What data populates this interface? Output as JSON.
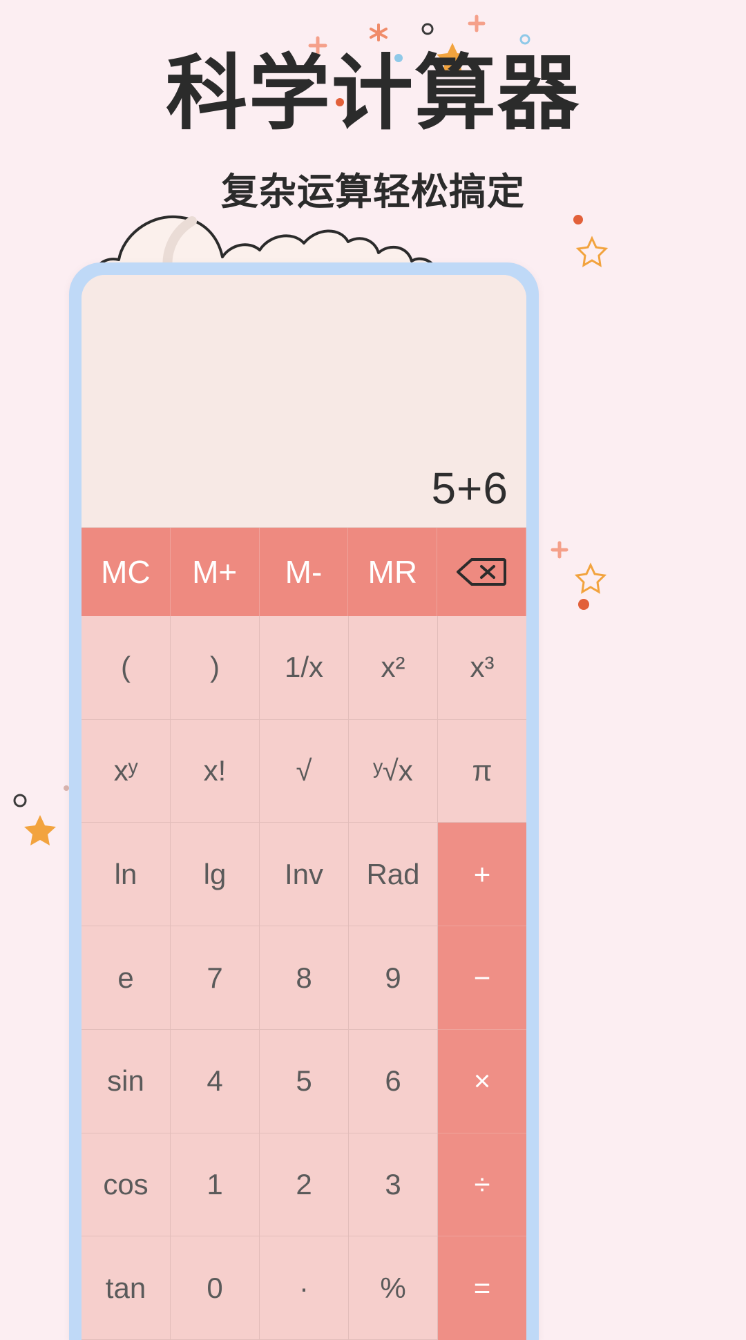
{
  "theme": {
    "page_bg": "#FCEEF2",
    "phone_frame": "#BFD9F7",
    "display_bg": "#F7E9E5",
    "key_bg": "#F6CFCC",
    "key_text": "#5A5A5A",
    "memory_bg": "#EE8A80",
    "operator_bg": "#EF8F86",
    "accent_text": "#FFFFFF",
    "title_color": "#2B2B2B"
  },
  "header": {
    "title": "科学计算器",
    "subtitle": "复杂运算轻松搞定"
  },
  "calculator": {
    "display": {
      "expression": "5+6"
    },
    "memory_row": [
      {
        "label": "MC",
        "name": "key-memory-clear"
      },
      {
        "label": "M+",
        "name": "key-memory-add"
      },
      {
        "label": "M-",
        "name": "key-memory-subtract"
      },
      {
        "label": "MR",
        "name": "key-memory-recall"
      },
      {
        "label": "",
        "name": "key-backspace",
        "icon": "backspace-icon"
      }
    ],
    "rows": [
      [
        {
          "label": "(",
          "name": "key-open-paren",
          "type": "fn"
        },
        {
          "label": ")",
          "name": "key-close-paren",
          "type": "fn"
        },
        {
          "label": "1/x",
          "name": "key-reciprocal",
          "type": "fn"
        },
        {
          "label": "x²",
          "name": "key-square",
          "type": "fn"
        },
        {
          "label": "x³",
          "name": "key-cube",
          "type": "fn"
        }
      ],
      [
        {
          "label": "xʸ",
          "name": "key-power",
          "type": "fn"
        },
        {
          "label": "x!",
          "name": "key-factorial",
          "type": "fn"
        },
        {
          "label": "√",
          "name": "key-square-root",
          "type": "fn"
        },
        {
          "label": "ʸ√x",
          "name": "key-nth-root",
          "type": "fn"
        },
        {
          "label": "π",
          "name": "key-pi",
          "type": "fn"
        }
      ],
      [
        {
          "label": "ln",
          "name": "key-natural-log",
          "type": "fn"
        },
        {
          "label": "lg",
          "name": "key-log10",
          "type": "fn"
        },
        {
          "label": "Inv",
          "name": "key-inverse",
          "type": "fn"
        },
        {
          "label": "Rad",
          "name": "key-radian-mode",
          "type": "fn"
        },
        {
          "label": "+",
          "name": "key-plus",
          "type": "op"
        }
      ],
      [
        {
          "label": "e",
          "name": "key-euler",
          "type": "fn"
        },
        {
          "label": "7",
          "name": "key-7",
          "type": "num"
        },
        {
          "label": "8",
          "name": "key-8",
          "type": "num"
        },
        {
          "label": "9",
          "name": "key-9",
          "type": "num"
        },
        {
          "label": "−",
          "name": "key-minus",
          "type": "op"
        }
      ],
      [
        {
          "label": "sin",
          "name": "key-sine",
          "type": "fn"
        },
        {
          "label": "4",
          "name": "key-4",
          "type": "num"
        },
        {
          "label": "5",
          "name": "key-5",
          "type": "num"
        },
        {
          "label": "6",
          "name": "key-6",
          "type": "num"
        },
        {
          "label": "×",
          "name": "key-multiply",
          "type": "op"
        }
      ],
      [
        {
          "label": "cos",
          "name": "key-cosine",
          "type": "fn"
        },
        {
          "label": "1",
          "name": "key-1",
          "type": "num"
        },
        {
          "label": "2",
          "name": "key-2",
          "type": "num"
        },
        {
          "label": "3",
          "name": "key-3",
          "type": "num"
        },
        {
          "label": "÷",
          "name": "key-divide",
          "type": "op"
        }
      ],
      [
        {
          "label": "tan",
          "name": "key-tangent",
          "type": "fn"
        },
        {
          "label": "0",
          "name": "key-0",
          "type": "num"
        },
        {
          "label": "·",
          "name": "key-decimal",
          "type": "num"
        },
        {
          "label": "%",
          "name": "key-percent",
          "type": "num"
        },
        {
          "label": "=",
          "name": "key-equals",
          "type": "op"
        }
      ]
    ]
  }
}
